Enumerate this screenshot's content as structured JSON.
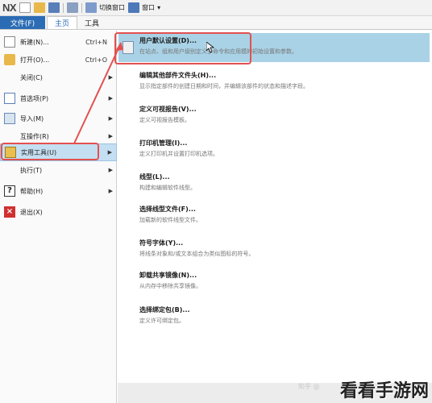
{
  "toolbar": {
    "logo": "NX",
    "switch_window": "切换窗口",
    "window": "窗口",
    "window_dropdown": "▾"
  },
  "tabs": [
    {
      "label": "文件(F)",
      "active": true
    },
    {
      "label": "主页"
    },
    {
      "label": "工具"
    }
  ],
  "file_menu": {
    "items": [
      {
        "label": "新建(N)...",
        "shortcut": "Ctrl+N",
        "icon": "new-file-icon"
      },
      {
        "label": "打开(O)...",
        "shortcut": "Ctrl+O",
        "icon": "open-folder-icon"
      },
      {
        "label": "关闭(C)",
        "submenu": true
      },
      {
        "label": "首选项(P)",
        "submenu": true,
        "icon": "preferences-icon"
      },
      {
        "label": "导入(M)",
        "submenu": true,
        "icon": "import-icon"
      },
      {
        "label": "互操作(R)",
        "submenu": true
      },
      {
        "label": "实用工具(U)",
        "submenu": true,
        "icon": "utilities-icon",
        "selected": true
      },
      {
        "label": "执行(T)",
        "submenu": true
      },
      {
        "label": "帮助(H)",
        "submenu": true,
        "icon": "help-icon"
      },
      {
        "label": "退出(X)",
        "icon": "exit-icon"
      }
    ]
  },
  "submenu": {
    "items": [
      {
        "title": "用户默认设置(D)...",
        "desc": "在站点、组和用户级别定义多命令和应用模的初始设置和参数。",
        "icon": "user-defaults-icon",
        "highlighted": true
      },
      {
        "title": "编辑其他部件文件头(H)...",
        "desc": "显示指定部件的创建日期和时间，并编辑该部件的状态和描述字段。"
      },
      {
        "title": "定义可视报告(V)...",
        "desc": "定义可视报告模板。"
      },
      {
        "title": "打印机管理(I)...",
        "desc": "定义打印机并设置打印机选项。"
      },
      {
        "title": "线型(L)...",
        "desc": "构建和编辑软件线型。"
      },
      {
        "title": "选择线型文件(F)...",
        "desc": "加载新的软件线型文件。"
      },
      {
        "title": "符号字体(Y)...",
        "desc": "将线条对象和/或文本组合为类似图标的符号。"
      },
      {
        "title": "卸载共享镜像(N)...",
        "desc": "从内存中移除共享镜像。"
      },
      {
        "title": "选择绑定包(B)...",
        "desc": "定义许可绑定包。"
      }
    ]
  },
  "watermark": {
    "site": "看看手游网",
    "source": "知乎 @"
  },
  "colors": {
    "ribbon_blue": "#2b6cb4",
    "selected_bg": "#c4dff2",
    "highlight_bg": "#a9d2e6",
    "annotation_red": "#e35050"
  }
}
